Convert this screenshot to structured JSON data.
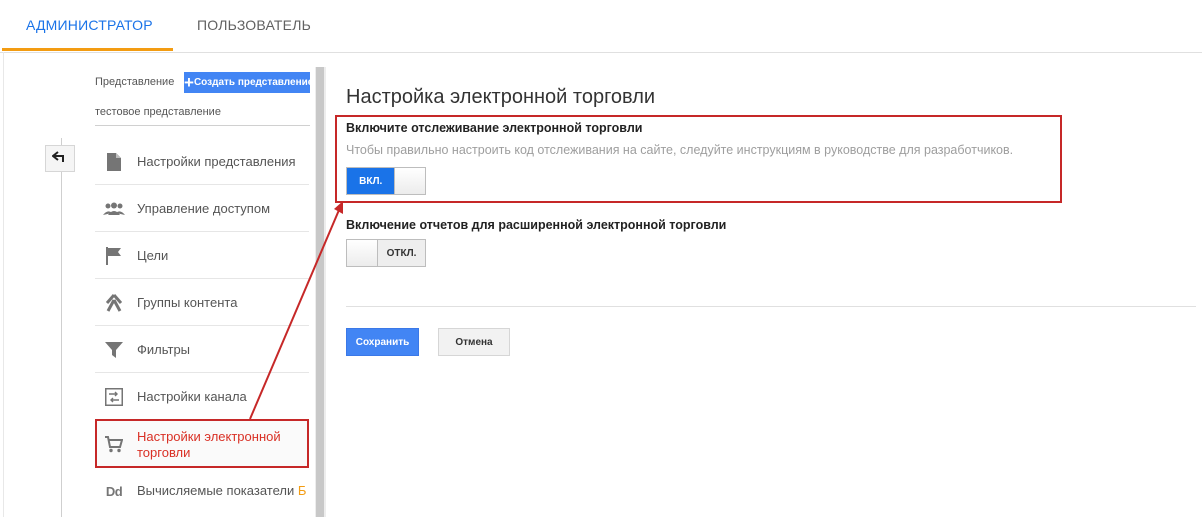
{
  "tabs": [
    {
      "label": "АДМИНИСТРАТОР",
      "active": true
    },
    {
      "label": "ПОЛЬЗОВАТЕЛЬ",
      "active": false
    }
  ],
  "view": {
    "label": "Представление",
    "create_button": "Создать представление",
    "current": "тестовое представление"
  },
  "sidebar": {
    "items": [
      {
        "label": "Настройки представления",
        "icon": "document-icon"
      },
      {
        "label": "Управление доступом",
        "icon": "people-icon"
      },
      {
        "label": "Цели",
        "icon": "flag-icon"
      },
      {
        "label": "Группы контента",
        "icon": "content-groups-icon"
      },
      {
        "label": "Фильтры",
        "icon": "filter-icon"
      },
      {
        "label": "Настройки канала",
        "icon": "channel-settings-icon"
      },
      {
        "label": "Настройки электронной торговли",
        "icon": "cart-icon",
        "active": true
      },
      {
        "label": "Вычисляемые показатели",
        "icon": "dd-icon",
        "trailing": "Б"
      }
    ]
  },
  "main": {
    "title": "Настройка электронной торговли",
    "tracking": {
      "title": "Включите отслеживание электронной торговли",
      "description": "Чтобы правильно настроить код отслеживания на сайте, следуйте инструкциям в руководстве для разработчиков.",
      "toggle_label": "ВКЛ.",
      "state": "on"
    },
    "enhanced": {
      "title": "Включение отчетов для расширенной электронной торговли",
      "toggle_label": "ОТКЛ.",
      "state": "off"
    },
    "save_label": "Сохранить",
    "cancel_label": "Отмена"
  },
  "colors": {
    "accent_blue": "#1a73e8",
    "button_blue": "#4285f4",
    "active_red": "#d93025",
    "annotation_red": "#c62828",
    "tab_indicator": "#f39c12"
  },
  "dd_glyph": "Dd"
}
